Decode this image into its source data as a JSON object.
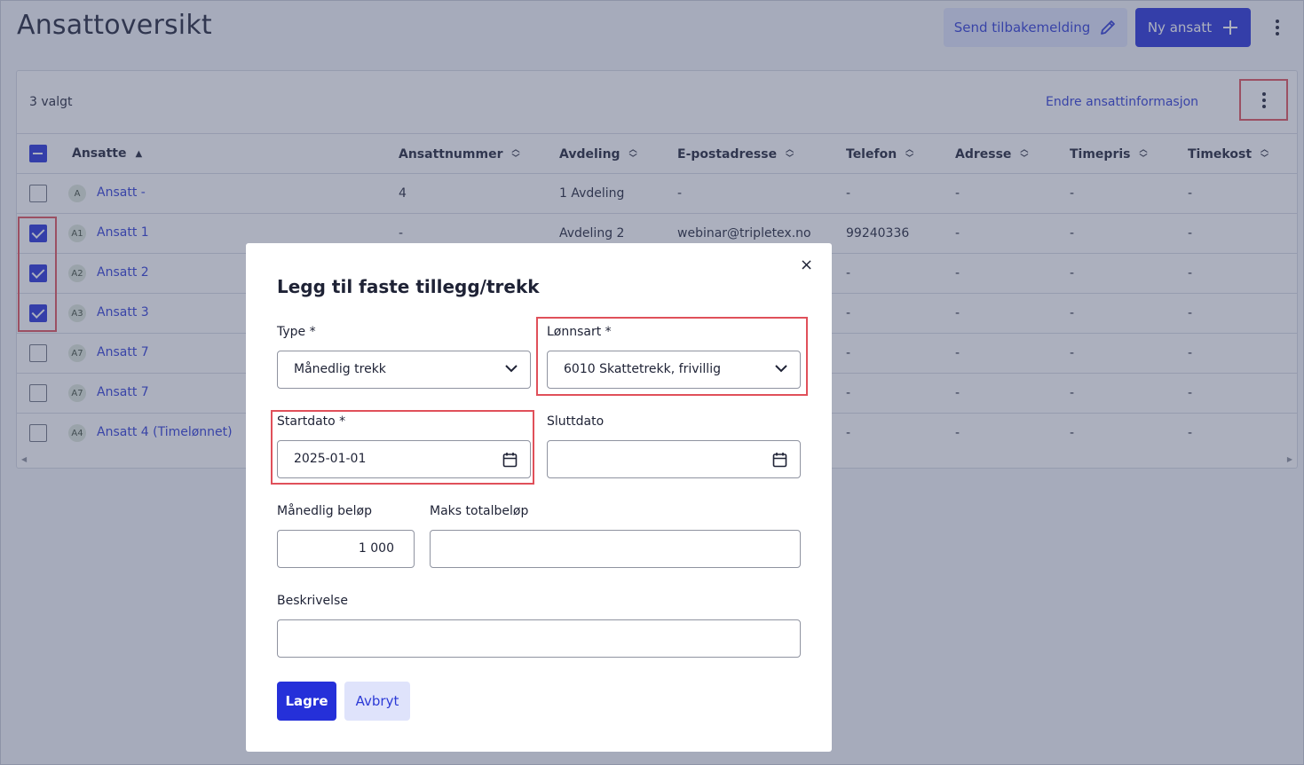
{
  "page": {
    "title": "Ansattoversikt",
    "feedback_button": "Send tilbakemelding",
    "new_employee_button": "Ny ansatt"
  },
  "toolbar": {
    "selected_count": "3 valgt",
    "edit_link": "Endre ansattinformasjon"
  },
  "table": {
    "columns": [
      "Ansatte",
      "Ansattnummer",
      "Avdeling",
      "E-postadresse",
      "Telefon",
      "Adresse",
      "Timepris",
      "Timekost"
    ],
    "rows": [
      {
        "initials": "A",
        "name": "Ansatt -",
        "checked": false,
        "number": "4",
        "department": "1 Avdeling",
        "email": "-",
        "phone": "-",
        "address": "-",
        "hourly_rate": "-",
        "hourly_cost": "-"
      },
      {
        "initials": "A1",
        "name": "Ansatt 1",
        "checked": true,
        "number": "-",
        "department": "Avdeling 2",
        "email": "webinar@tripletex.no",
        "phone": "99240336",
        "address": "-",
        "hourly_rate": "-",
        "hourly_cost": "-"
      },
      {
        "initials": "A2",
        "name": "Ansatt 2",
        "checked": true,
        "phone": "-",
        "address": "-",
        "hourly_rate": "-",
        "hourly_cost": "-"
      },
      {
        "initials": "A3",
        "name": "Ansatt 3",
        "checked": true,
        "phone": "-",
        "address": "-",
        "hourly_rate": "-",
        "hourly_cost": "-"
      },
      {
        "initials": "A7",
        "name": "Ansatt 7",
        "checked": false,
        "phone": "-",
        "address": "-",
        "hourly_rate": "-",
        "hourly_cost": "-"
      },
      {
        "initials": "A7",
        "name": "Ansatt 7",
        "checked": false,
        "phone": "-",
        "address": "-",
        "hourly_rate": "-",
        "hourly_cost": "-"
      },
      {
        "initials": "A4",
        "name": "Ansatt 4 (Timelønnet)",
        "checked": false,
        "phone": "-",
        "address": "-",
        "hourly_rate": "-",
        "hourly_cost": "-"
      }
    ]
  },
  "modal": {
    "title": "Legg til faste tillegg/trekk",
    "close_symbol": "×",
    "type_label": "Type *",
    "type_value": "Månedlig trekk",
    "wage_type_label": "Lønnsart *",
    "wage_type_value": "6010 Skattetrekk, frivillig",
    "start_date_label": "Startdato *",
    "start_date_value": "2025-01-01",
    "end_date_label": "Sluttdato",
    "end_date_value": "",
    "monthly_amount_label": "Månedlig beløp",
    "monthly_amount_value": "1 000",
    "max_total_label": "Maks totalbeløp",
    "max_total_value": "",
    "description_label": "Beskrivelse",
    "description_value": "",
    "save_button": "Lagre",
    "cancel_button": "Avbryt"
  },
  "colors": {
    "primary": "#2530d9",
    "link": "#2c3ad6",
    "highlight": "#e0505a",
    "overlay": "rgba(70, 80, 110, 0.45)"
  }
}
